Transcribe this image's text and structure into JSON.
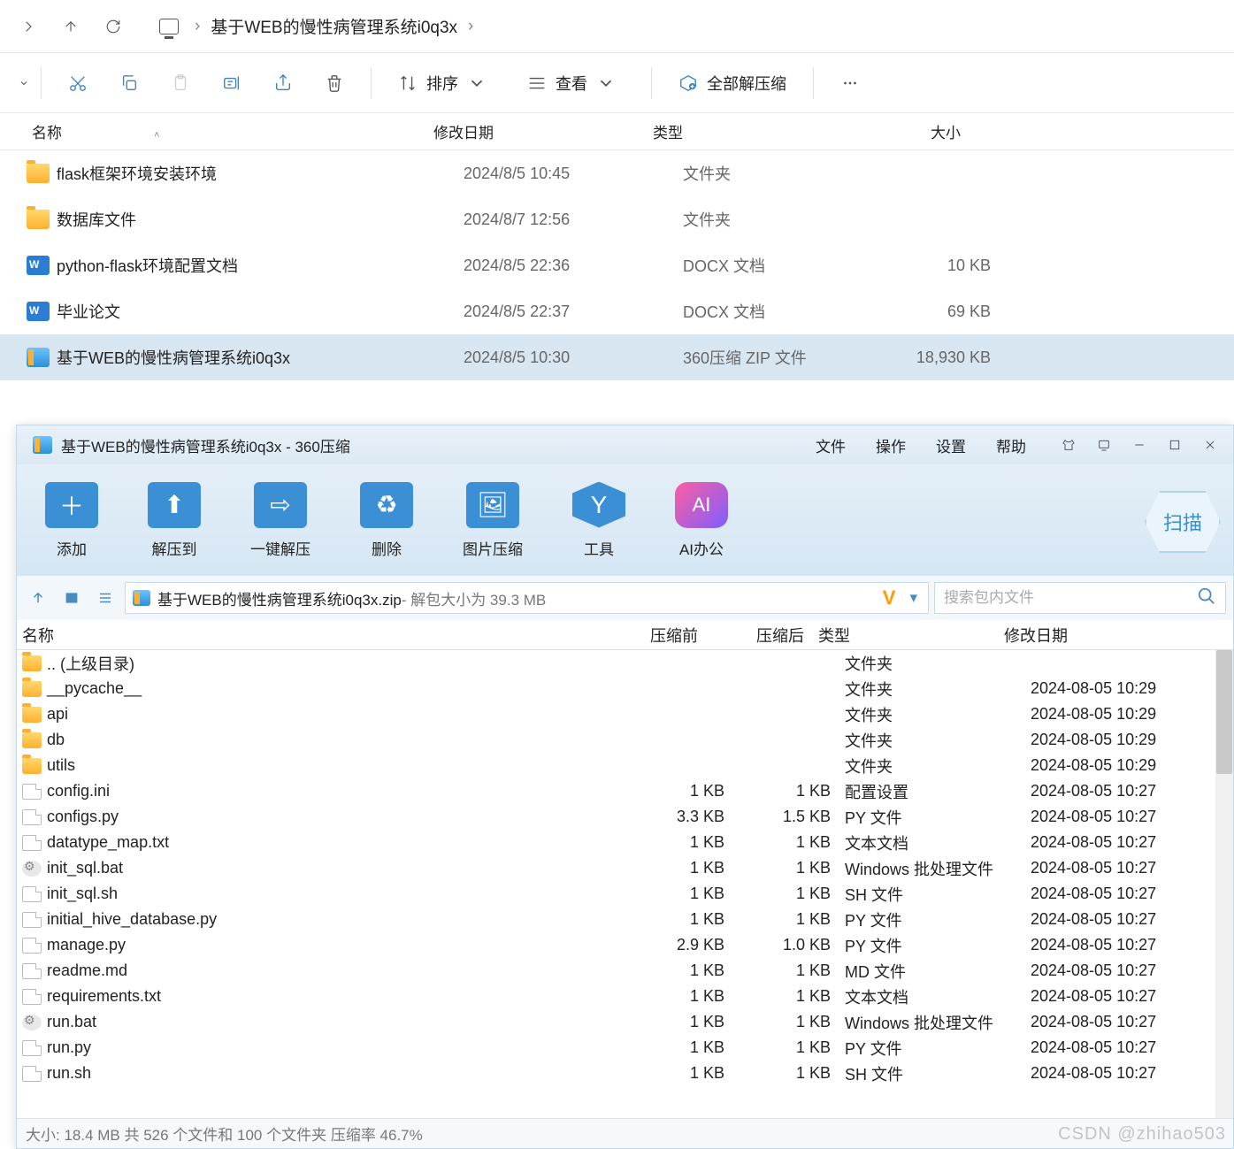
{
  "explorer": {
    "breadcrumb": "基于WEB的慢性病管理系统i0q3x",
    "sort_label": "排序",
    "view_label": "查看",
    "extract_all_label": "全部解压缩",
    "columns": {
      "name": "名称",
      "date": "修改日期",
      "type": "类型",
      "size": "大小"
    },
    "rows": [
      {
        "icon": "folder",
        "name": "flask框架环境安装环境",
        "date": "2024/8/5 10:45",
        "type": "文件夹",
        "size": ""
      },
      {
        "icon": "folder",
        "name": "数据库文件",
        "date": "2024/8/7 12:56",
        "type": "文件夹",
        "size": ""
      },
      {
        "icon": "docx",
        "name": "python-flask环境配置文档",
        "date": "2024/8/5 22:36",
        "type": "DOCX 文档",
        "size": "10 KB"
      },
      {
        "icon": "docx",
        "name": "毕业论文",
        "date": "2024/8/5 22:37",
        "type": "DOCX 文档",
        "size": "69 KB"
      },
      {
        "icon": "zip",
        "name": "基于WEB的慢性病管理系统i0q3x",
        "date": "2024/8/5 10:30",
        "type": "360压缩 ZIP 文件",
        "size": "18,930 KB",
        "selected": true
      }
    ]
  },
  "archive": {
    "title": "基于WEB的慢性病管理系统i0q3x - 360压缩",
    "menu": {
      "file": "文件",
      "operate": "操作",
      "settings": "设置",
      "help": "帮助"
    },
    "toolbar": {
      "add": "添加",
      "extract_to": "解压到",
      "one_click": "一键解压",
      "delete": "删除",
      "image_compress": "图片压缩",
      "tools": "工具",
      "ai_office": "AI办公",
      "scan": "扫描"
    },
    "path": {
      "zip_name": "基于WEB的慢性病管理系统i0q3x.zip",
      "info": " - 解包大小为 39.3 MB"
    },
    "search_placeholder": "搜索包内文件",
    "columns": {
      "name": "名称",
      "pre": "压缩前",
      "post": "压缩后",
      "type": "类型",
      "date": "修改日期"
    },
    "rows": [
      {
        "icon": "folder",
        "name": ".. (上级目录)",
        "pre": "",
        "post": "",
        "type": "文件夹",
        "date": ""
      },
      {
        "icon": "folder",
        "name": "__pycache__",
        "pre": "",
        "post": "",
        "type": "文件夹",
        "date": "2024-08-05 10:29"
      },
      {
        "icon": "folder",
        "name": "api",
        "pre": "",
        "post": "",
        "type": "文件夹",
        "date": "2024-08-05 10:29"
      },
      {
        "icon": "folder",
        "name": "db",
        "pre": "",
        "post": "",
        "type": "文件夹",
        "date": "2024-08-05 10:29"
      },
      {
        "icon": "folder",
        "name": "utils",
        "pre": "",
        "post": "",
        "type": "文件夹",
        "date": "2024-08-05 10:29"
      },
      {
        "icon": "file",
        "name": "config.ini",
        "pre": "1 KB",
        "post": "1 KB",
        "type": "配置设置",
        "date": "2024-08-05 10:27"
      },
      {
        "icon": "file",
        "name": "configs.py",
        "pre": "3.3 KB",
        "post": "1.5 KB",
        "type": "PY 文件",
        "date": "2024-08-05 10:27"
      },
      {
        "icon": "file",
        "name": "datatype_map.txt",
        "pre": "1 KB",
        "post": "1 KB",
        "type": "文本文档",
        "date": "2024-08-05 10:27"
      },
      {
        "icon": "gear",
        "name": "init_sql.bat",
        "pre": "1 KB",
        "post": "1 KB",
        "type": "Windows 批处理文件",
        "date": "2024-08-05 10:27"
      },
      {
        "icon": "file",
        "name": "init_sql.sh",
        "pre": "1 KB",
        "post": "1 KB",
        "type": "SH 文件",
        "date": "2024-08-05 10:27"
      },
      {
        "icon": "file",
        "name": "initial_hive_database.py",
        "pre": "1 KB",
        "post": "1 KB",
        "type": "PY 文件",
        "date": "2024-08-05 10:27"
      },
      {
        "icon": "file",
        "name": "manage.py",
        "pre": "2.9 KB",
        "post": "1.0 KB",
        "type": "PY 文件",
        "date": "2024-08-05 10:27"
      },
      {
        "icon": "file",
        "name": "readme.md",
        "pre": "1 KB",
        "post": "1 KB",
        "type": "MD 文件",
        "date": "2024-08-05 10:27"
      },
      {
        "icon": "file",
        "name": "requirements.txt",
        "pre": "1 KB",
        "post": "1 KB",
        "type": "文本文档",
        "date": "2024-08-05 10:27"
      },
      {
        "icon": "gear",
        "name": "run.bat",
        "pre": "1 KB",
        "post": "1 KB",
        "type": "Windows 批处理文件",
        "date": "2024-08-05 10:27"
      },
      {
        "icon": "file",
        "name": "run.py",
        "pre": "1 KB",
        "post": "1 KB",
        "type": "PY 文件",
        "date": "2024-08-05 10:27"
      },
      {
        "icon": "file",
        "name": "run.sh",
        "pre": "1 KB",
        "post": "1 KB",
        "type": "SH 文件",
        "date": "2024-08-05 10:27"
      }
    ],
    "status": "大小: 18.4 MB 共 526 个文件和 100 个文件夹 压缩率 46.7%"
  },
  "watermark": "CSDN @zhihao503"
}
